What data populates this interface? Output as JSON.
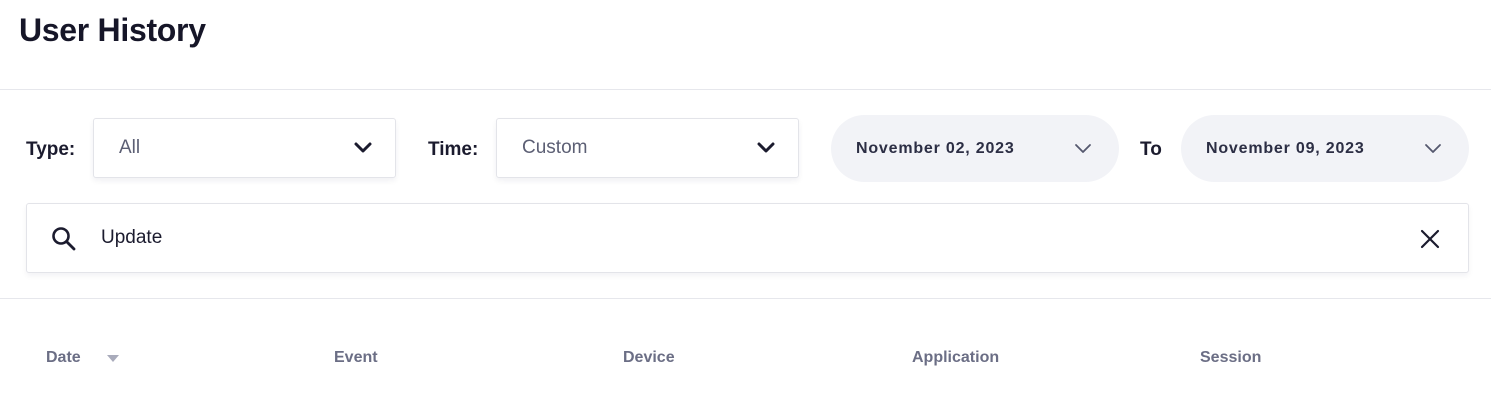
{
  "page": {
    "title": "User History"
  },
  "filters": {
    "type": {
      "label": "Type:",
      "value": "All",
      "icon": "chevron-down-icon"
    },
    "time": {
      "label": "Time:",
      "value": "Custom",
      "icon": "chevron-down-icon"
    },
    "date_range": {
      "from": "November 02, 2023",
      "separator": "To",
      "to": "November 09, 2023",
      "icon": "chevron-down-icon"
    }
  },
  "search": {
    "value": "Update",
    "icon": "search-icon",
    "clear_icon": "close-icon"
  },
  "table": {
    "columns": [
      "Date",
      "Event",
      "Device",
      "Application",
      "Session"
    ],
    "sort_icon": "sort-descending-icon"
  },
  "colors": {
    "title": "#161628",
    "pill_background": "#f2f3f7",
    "header_text": "#6b6e85",
    "border": "#e3e4e9"
  }
}
